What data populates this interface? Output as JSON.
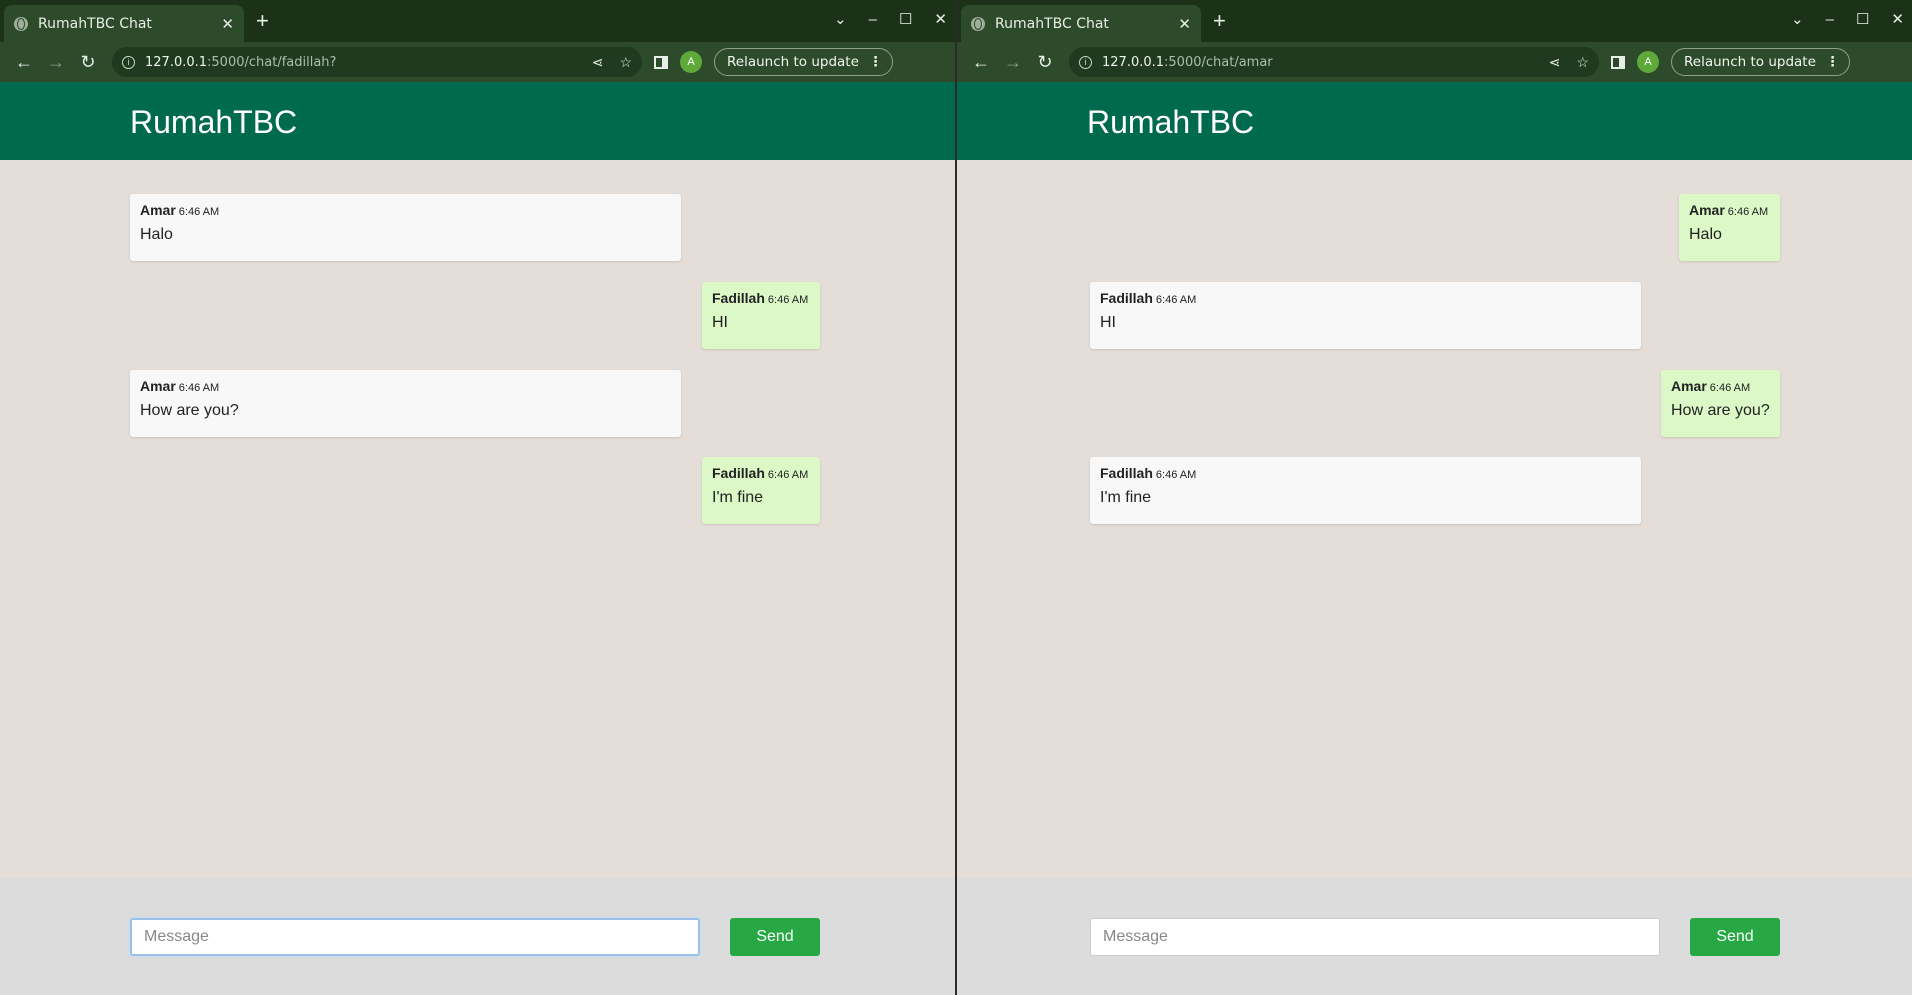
{
  "left": {
    "tab_title": "RumahTBC Chat",
    "url_host": "127.0.0.1",
    "url_path": ":5000/chat/fadillah?",
    "relaunch_label": "Relaunch to update",
    "avatar_letter": "A",
    "app_title": "RumahTBC",
    "messages": [
      {
        "name": "Amar",
        "time": "6:46 AM",
        "text": "Halo",
        "side": "in"
      },
      {
        "name": "Fadillah",
        "time": "6:46 AM",
        "text": "HI",
        "side": "out"
      },
      {
        "name": "Amar",
        "time": "6:46 AM",
        "text": "How are you?",
        "side": "in"
      },
      {
        "name": "Fadillah",
        "time": "6:46 AM",
        "text": "I'm fine",
        "side": "out"
      }
    ],
    "input_placeholder": "Message",
    "send_label": "Send"
  },
  "right": {
    "tab_title": "RumahTBC Chat",
    "url_host": "127.0.0.1",
    "url_path": ":5000/chat/amar",
    "relaunch_label": "Relaunch to update",
    "avatar_letter": "A",
    "app_title": "RumahTBC",
    "messages": [
      {
        "name": "Amar",
        "time": "6:46 AM",
        "text": "Halo",
        "side": "out"
      },
      {
        "name": "Fadillah",
        "time": "6:46 AM",
        "text": "HI",
        "side": "in"
      },
      {
        "name": "Amar",
        "time": "6:46 AM",
        "text": "How are you?",
        "side": "out"
      },
      {
        "name": "Fadillah",
        "time": "6:46 AM",
        "text": "I'm fine",
        "side": "in"
      }
    ],
    "input_placeholder": "Message",
    "send_label": "Send"
  },
  "colors": {
    "header": "#006a4e",
    "chat_bg": "#e5ddd8",
    "bubble_in": "#f8f8f8",
    "bubble_out": "#dcf8c6",
    "send_button": "#28a745"
  }
}
